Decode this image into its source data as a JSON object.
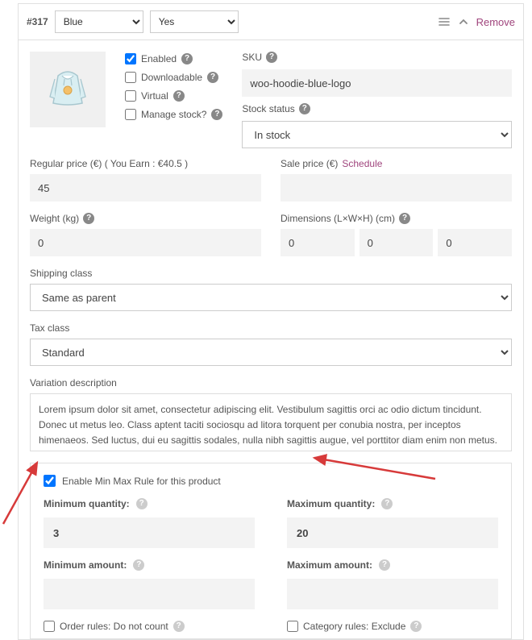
{
  "header": {
    "variation_id": "#317",
    "attr1_selected": "Blue",
    "attr2_selected": "Yes",
    "remove_label": "Remove"
  },
  "checks": {
    "enabled": {
      "label": "Enabled",
      "checked": true
    },
    "downloadable": {
      "label": "Downloadable",
      "checked": false
    },
    "virtual": {
      "label": "Virtual",
      "checked": false
    },
    "manage_stock": {
      "label": "Manage stock?",
      "checked": false
    }
  },
  "sku": {
    "label": "SKU",
    "value": "woo-hoodie-blue-logo"
  },
  "stock": {
    "label": "Stock status",
    "selected": "In stock"
  },
  "regular_price": {
    "label": "Regular price (€) ( You Earn : €40.5 )",
    "value": "45"
  },
  "sale_price": {
    "label": "Sale price (€)",
    "schedule": "Schedule",
    "value": ""
  },
  "weight": {
    "label": "Weight (kg)",
    "value": "0"
  },
  "dimensions": {
    "label": "Dimensions (L×W×H) (cm)",
    "l": "0",
    "w": "0",
    "h": "0"
  },
  "shipping_class": {
    "label": "Shipping class",
    "selected": "Same as parent"
  },
  "tax_class": {
    "label": "Tax class",
    "selected": "Standard"
  },
  "description": {
    "label": "Variation description",
    "value": "Lorem ipsum dolor sit amet, consectetur adipiscing elit. Vestibulum sagittis orci ac odio dictum tincidunt. Donec ut metus leo. Class aptent taciti sociosqu ad litora torquent per conubia nostra, per inceptos himenaeos. Sed luctus, dui eu sagittis sodales, nulla nibh sagittis augue, vel porttitor diam enim non metus. Vestibulum aliquam augue neque. Phasellus tincidunt odio eget ullamcorper efficitur. Cras placerat ut"
  },
  "minmax": {
    "enable": {
      "label": "Enable Min Max Rule for this product",
      "checked": true
    },
    "min_qty": {
      "label": "Minimum quantity:",
      "value": "3"
    },
    "max_qty": {
      "label": "Maximum quantity:",
      "value": "20"
    },
    "min_amt": {
      "label": "Minimum amount:",
      "value": ""
    },
    "max_amt": {
      "label": "Maximum amount:",
      "value": ""
    },
    "order_rules": {
      "label": "Order rules: Do not count",
      "checked": false
    },
    "category_rules": {
      "label": "Category rules: Exclude",
      "checked": false
    }
  }
}
